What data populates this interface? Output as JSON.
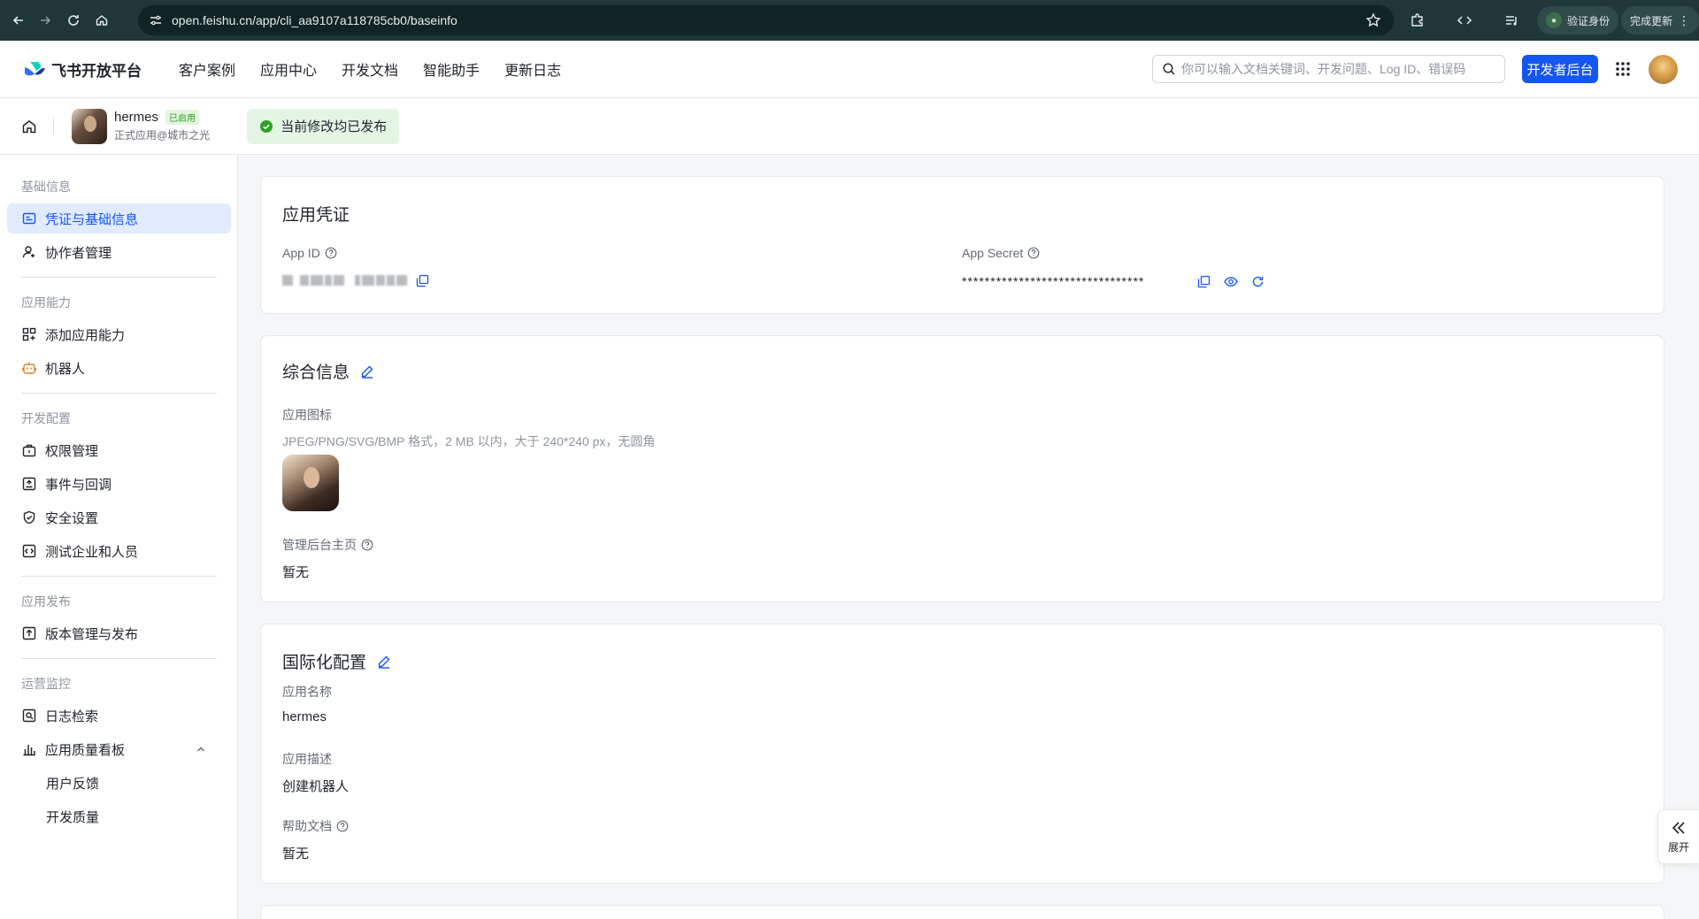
{
  "browser": {
    "url": "open.feishu.cn/app/cli_aa9107a118785cb0/baseinfo",
    "verify_label": "验证身份",
    "update_label": "完成更新"
  },
  "topnav": {
    "logo_text": "飞书开放平台",
    "menu": [
      "客户案例",
      "应用中心",
      "开发文档",
      "智能助手",
      "更新日志"
    ],
    "search_placeholder": "你可以输入文档关键词、开发问题、Log ID、错误码",
    "dev_button": "开发者后台"
  },
  "app_header": {
    "name": "hermes",
    "badge": "已启用",
    "subtitle": "正式应用@城市之光",
    "status": "当前修改均已发布"
  },
  "sidebar": {
    "groups": [
      {
        "title": "基础信息",
        "items": [
          {
            "label": "凭证与基础信息",
            "icon": "credential-icon",
            "active": true
          },
          {
            "label": "协作者管理",
            "icon": "user-add-icon"
          }
        ]
      },
      {
        "title": "应用能力",
        "items": [
          {
            "label": "添加应用能力",
            "icon": "apps-add-icon"
          },
          {
            "label": "机器人",
            "icon": "robot-icon"
          }
        ]
      },
      {
        "title": "开发配置",
        "items": [
          {
            "label": "权限管理",
            "icon": "briefcase-icon"
          },
          {
            "label": "事件与回调",
            "icon": "event-icon"
          },
          {
            "label": "安全设置",
            "icon": "shield-icon"
          },
          {
            "label": "测试企业和人员",
            "icon": "code-box-icon"
          }
        ]
      },
      {
        "title": "应用发布",
        "items": [
          {
            "label": "版本管理与发布",
            "icon": "upload-box-icon"
          }
        ]
      },
      {
        "title": "运营监控",
        "items": [
          {
            "label": "日志检索",
            "icon": "log-search-icon"
          },
          {
            "label": "应用质量看板",
            "icon": "bar-chart-icon",
            "expanded": true
          },
          {
            "label": "用户反馈",
            "sub": true
          },
          {
            "label": "开发质量",
            "sub": true
          }
        ]
      }
    ]
  },
  "credentials": {
    "title": "应用凭证",
    "app_id_label": "App ID",
    "app_secret_label": "App Secret",
    "app_secret_value": "********************************"
  },
  "general": {
    "title": "综合信息",
    "icon_label": "应用图标",
    "icon_hint": "JPEG/PNG/SVG/BMP 格式，2 MB 以内，大于 240*240 px，无圆角",
    "admin_home_label": "管理后台主页",
    "admin_home_value": "暂无"
  },
  "i18n": {
    "title": "国际化配置",
    "name_label": "应用名称",
    "name_value": "hermes",
    "desc_label": "应用描述",
    "desc_value": "创建机器人",
    "help_label": "帮助文档",
    "help_value": "暂无"
  },
  "expand_label": "展开",
  "colors": {
    "accent": "#1456f0",
    "active_bg": "#e1eaff",
    "success": "#2ea121",
    "browser_bg": "#1f3737"
  }
}
